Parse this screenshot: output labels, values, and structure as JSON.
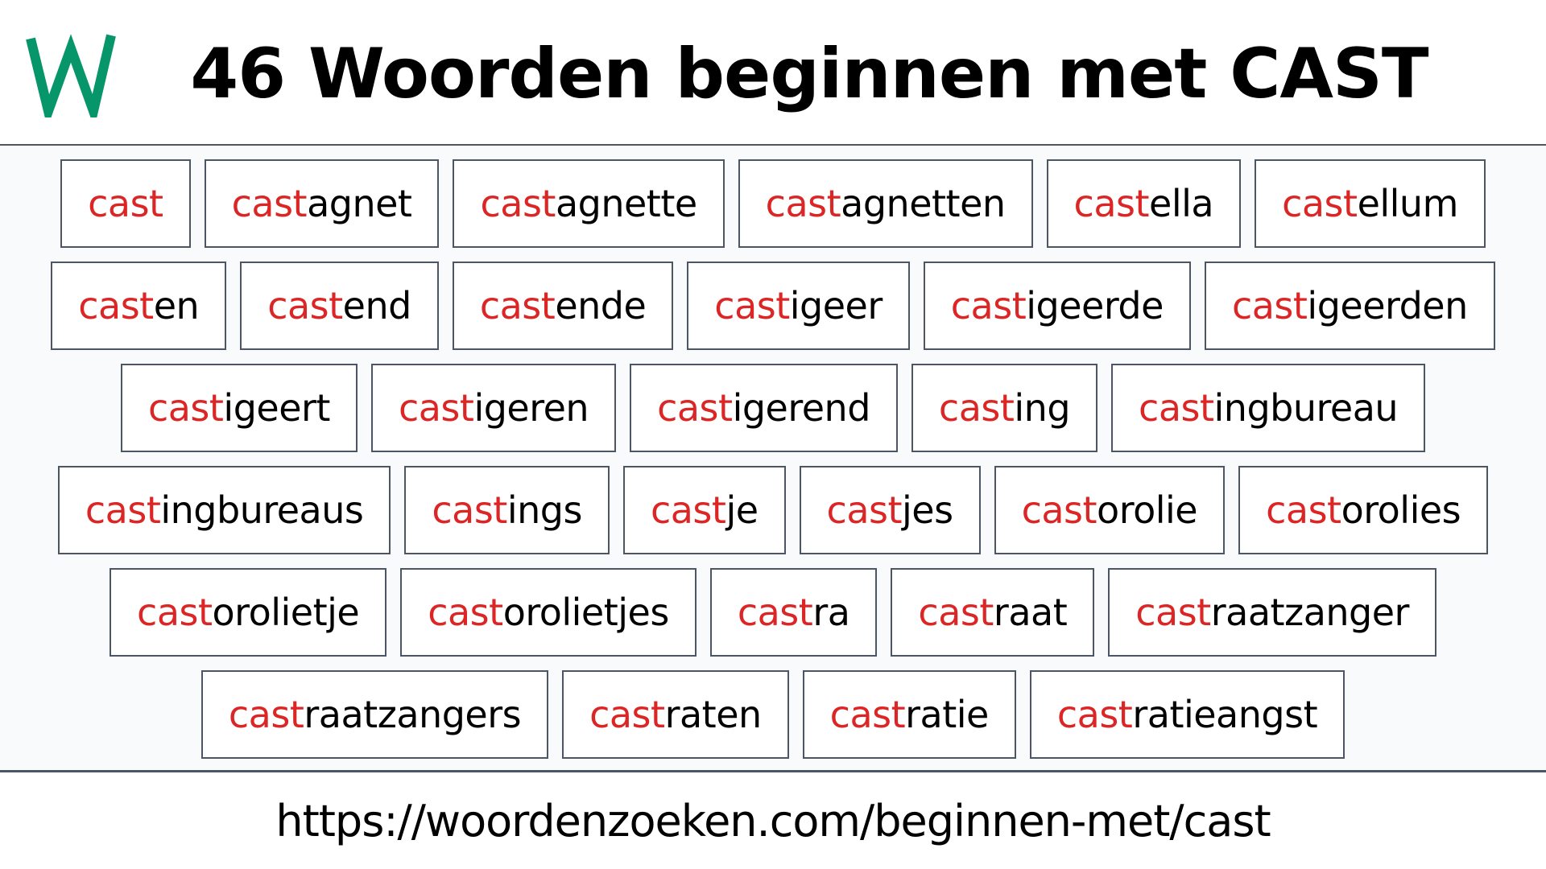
{
  "header": {
    "logo_letter": "W",
    "logo_color": "#079669",
    "title": "46 Woorden beginnen met CAST"
  },
  "highlight_color": "#dc2626",
  "prefix": "cast",
  "rows": [
    [
      "cast",
      "castagnet",
      "castagnette",
      "castagnetten",
      "castella",
      "castellum"
    ],
    [
      "casten",
      "castend",
      "castende",
      "castigeer",
      "castigeerde",
      "castigeerden"
    ],
    [
      "castigeert",
      "castigeren",
      "castigerend",
      "casting",
      "castingbureau"
    ],
    [
      "castingbureaus",
      "castings",
      "castje",
      "castjes",
      "castorolie",
      "castorolies"
    ],
    [
      "castorolietje",
      "castorolietjes",
      "castra",
      "castraat",
      "castraatzanger"
    ],
    [
      "castraatzangers",
      "castraten",
      "castratie",
      "castratieangst"
    ]
  ],
  "footer": {
    "url": "https://woordenzoeken.com/beginnen-met/cast"
  }
}
